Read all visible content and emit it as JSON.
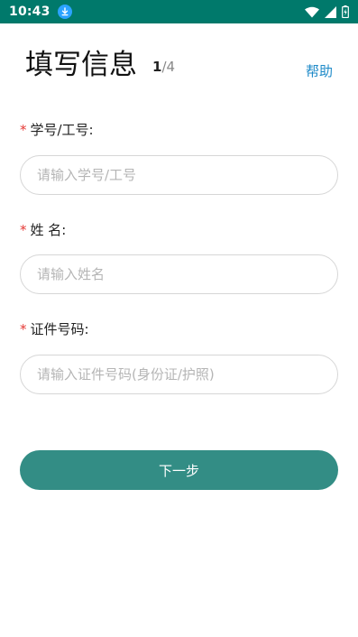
{
  "status_bar": {
    "time": "10:43",
    "icons": [
      "download-icon",
      "wifi-icon",
      "signal-icon",
      "battery-icon"
    ]
  },
  "header": {
    "title": "填写信息",
    "step_current": "1",
    "step_total": "/4",
    "help_label": "帮助"
  },
  "form": {
    "required_mark": "*",
    "fields": [
      {
        "label": "学号/工号:",
        "placeholder": "请输入学号/工号",
        "value": ""
      },
      {
        "label": "姓 名:",
        "placeholder": "请输入姓名",
        "value": ""
      },
      {
        "label": "证件号码:",
        "placeholder": "请输入证件号码(身份证/护照)",
        "value": ""
      }
    ]
  },
  "actions": {
    "next_label": "下一步"
  },
  "colors": {
    "status_bar": "#00796b",
    "primary_button": "#338d85",
    "help_link": "#1e8ac8",
    "required": "#e53935"
  }
}
